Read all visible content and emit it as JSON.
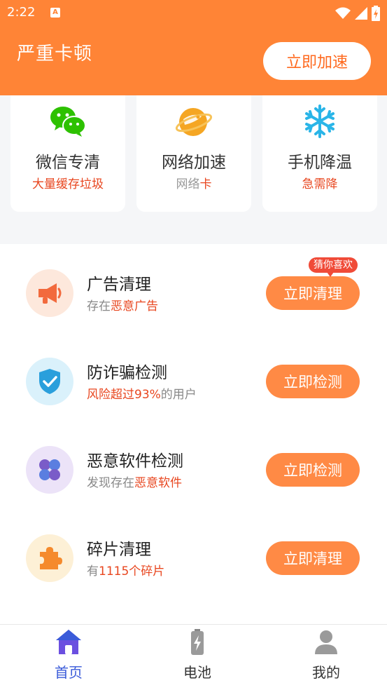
{
  "status_bar": {
    "time": "2:22",
    "notification_icon": "A"
  },
  "header": {
    "title": "严重卡顿",
    "button_label": "立即加速"
  },
  "quick_cards": [
    {
      "icon": "wechat-icon",
      "title": "微信专清",
      "subtitle": "大量缓存垃圾",
      "subtitle_color": "#e8461f"
    },
    {
      "icon": "planet-icon",
      "title": "网络加速",
      "subtitle_prefix": "网络",
      "subtitle_highlight": "卡"
    },
    {
      "icon": "snowflake-icon",
      "title": "手机降温",
      "subtitle": "急需降",
      "subtitle_color": "#e8461f"
    }
  ],
  "list": [
    {
      "icon": "megaphone-icon",
      "title": "广告清理",
      "sub_prefix": "存在",
      "sub_highlight": "恶意广告",
      "sub_suffix": "",
      "button": "立即清理",
      "badge": "猜你喜欢"
    },
    {
      "icon": "shield-icon",
      "title": "防诈骗检测",
      "sub_prefix": "",
      "sub_highlight": "风险超过93%",
      "sub_suffix": "的用户",
      "button": "立即检测"
    },
    {
      "icon": "app-grid-icon",
      "title": "恶意软件检测",
      "sub_prefix": "发现存在",
      "sub_highlight": "恶意软件",
      "sub_suffix": "",
      "button": "立即检测"
    },
    {
      "icon": "puzzle-icon",
      "title": "碎片清理",
      "sub_prefix": "有",
      "sub_highlight": "1115个碎片",
      "sub_suffix": "",
      "button": "立即清理"
    }
  ],
  "tabs": [
    {
      "icon": "home-icon",
      "label": "首页",
      "active": true
    },
    {
      "icon": "battery-icon",
      "label": "电池",
      "active": false
    },
    {
      "icon": "user-icon",
      "label": "我的",
      "active": false
    }
  ],
  "colors": {
    "accent": "#ff8436",
    "button": "#ff8a45",
    "highlight": "#e8461f",
    "tab_active": "#3a5bd9"
  }
}
